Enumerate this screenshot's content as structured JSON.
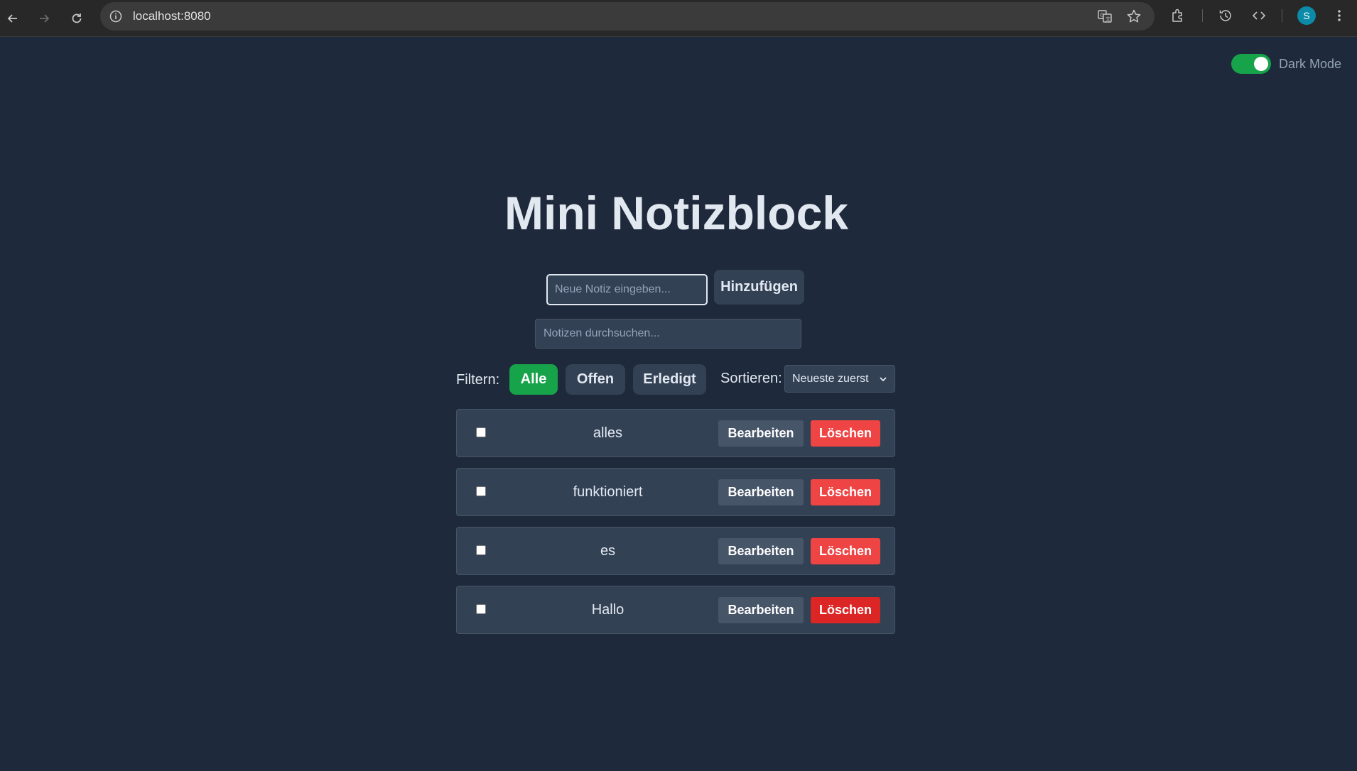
{
  "browser": {
    "url": "localhost:8080",
    "avatar_letter": "S"
  },
  "toggle": {
    "label": "Dark Mode",
    "on": true
  },
  "app": {
    "title": "Mini Notizblock",
    "new_note_placeholder": "Neue Notiz eingeben...",
    "add_label": "Hinzufügen",
    "search_placeholder": "Notizen durchsuchen...",
    "filter_label": "Filtern:",
    "filters": [
      "Alle",
      "Offen",
      "Erledigt"
    ],
    "active_filter": "Alle",
    "sort_label": "Sortieren:",
    "sort_value": "Neueste zuerst"
  },
  "notes": [
    {
      "text": "alles",
      "done": false,
      "edit_label": "Bearbeiten",
      "delete_label": "Löschen"
    },
    {
      "text": "funktioniert",
      "done": false,
      "edit_label": "Bearbeiten",
      "delete_label": "Löschen"
    },
    {
      "text": "es",
      "done": false,
      "edit_label": "Bearbeiten",
      "delete_label": "Löschen"
    },
    {
      "text": "Hallo",
      "done": false,
      "edit_label": "Bearbeiten",
      "delete_label": "Löschen"
    }
  ],
  "colors": {
    "background": "#1e293b",
    "card": "#334155",
    "accent_green": "#16a34a",
    "delete_red": "#ef4444"
  }
}
